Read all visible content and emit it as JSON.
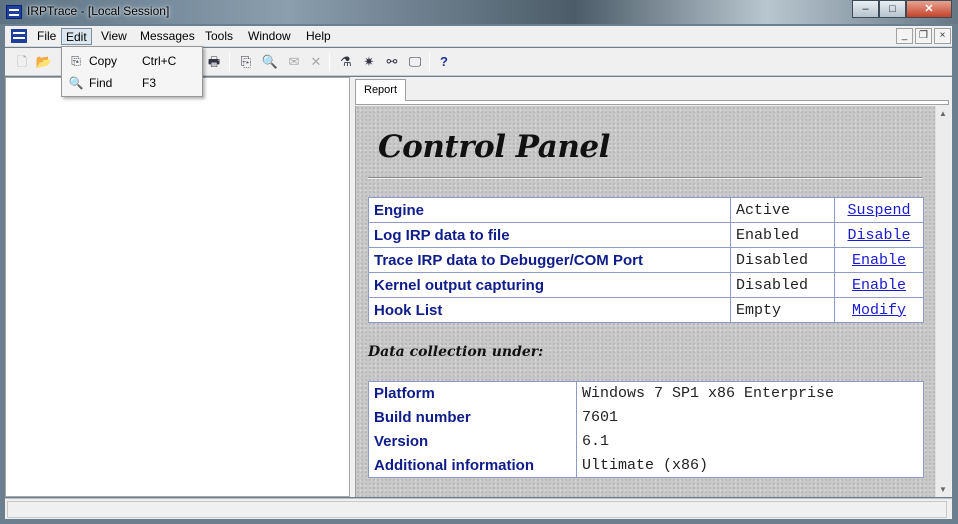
{
  "window": {
    "title": "IRPTrace - [Local Session]",
    "controls": {
      "minimize": "–",
      "maximize": "□",
      "close": "✕"
    }
  },
  "menubar": {
    "items": [
      "File",
      "Edit",
      "View",
      "Messages",
      "Tools",
      "Window",
      "Help"
    ],
    "active": "Edit",
    "mdi_controls": {
      "minimize": "_",
      "restore": "❐",
      "close": "×"
    }
  },
  "toolbar": {
    "buttons": [
      {
        "icon": "new-document-icon",
        "glyph": "🗋",
        "enabled": false
      },
      {
        "icon": "open-folder-icon",
        "glyph": "📂",
        "enabled": false
      },
      {
        "icon": "print-icon",
        "glyph": "🖶",
        "enabled": true
      },
      {
        "icon": "copy-icon",
        "glyph": "⎘",
        "enabled": true
      },
      {
        "icon": "find-icon",
        "glyph": "🔍",
        "enabled": true
      },
      {
        "icon": "mail-icon",
        "glyph": "✉",
        "enabled": false
      },
      {
        "icon": "delete-icon",
        "glyph": "✕",
        "enabled": false
      },
      {
        "icon": "filter-icon",
        "glyph": "⚗",
        "enabled": true
      },
      {
        "icon": "capture-icon",
        "glyph": "✷",
        "enabled": true
      },
      {
        "icon": "binoculars-icon",
        "glyph": "⚯",
        "enabled": true
      },
      {
        "icon": "monitor-icon",
        "glyph": "🖵",
        "enabled": true
      },
      {
        "icon": "help-icon",
        "glyph": "?",
        "enabled": true
      }
    ]
  },
  "edit_menu": {
    "items": [
      {
        "label": "Copy",
        "shortcut": "Ctrl+C",
        "icon": "copy-icon",
        "glyph": "⎘"
      },
      {
        "label": "Find",
        "shortcut": "F3",
        "icon": "find-icon",
        "glyph": "🔍"
      }
    ]
  },
  "tabs": {
    "report": "Report"
  },
  "report": {
    "title": "Control Panel",
    "status_rows": [
      {
        "label": "Engine",
        "value": "Active",
        "action": "Suspend"
      },
      {
        "label": "Log IRP data to file",
        "value": "Enabled",
        "action": "Disable"
      },
      {
        "label": "Trace IRP data to Debugger/COM Port",
        "value": "Disabled",
        "action": "Enable"
      },
      {
        "label": "Kernel output capturing",
        "value": "Disabled",
        "action": "Enable"
      },
      {
        "label": "Hook List",
        "value": "Empty",
        "action": "Modify"
      }
    ],
    "data_collection_label": "Data collection under:",
    "info_rows": [
      {
        "label": "Platform",
        "value": "Windows 7 SP1 x86 Enterprise"
      },
      {
        "label": "Build number",
        "value": "7601"
      },
      {
        "label": "Version",
        "value": "6.1"
      },
      {
        "label": "Additional information",
        "value": "Ultimate (x86)"
      }
    ]
  },
  "colors": {
    "label_blue": "#0f1c8a",
    "link_blue": "#1a1ad0",
    "table_border": "#8e9ac8"
  }
}
